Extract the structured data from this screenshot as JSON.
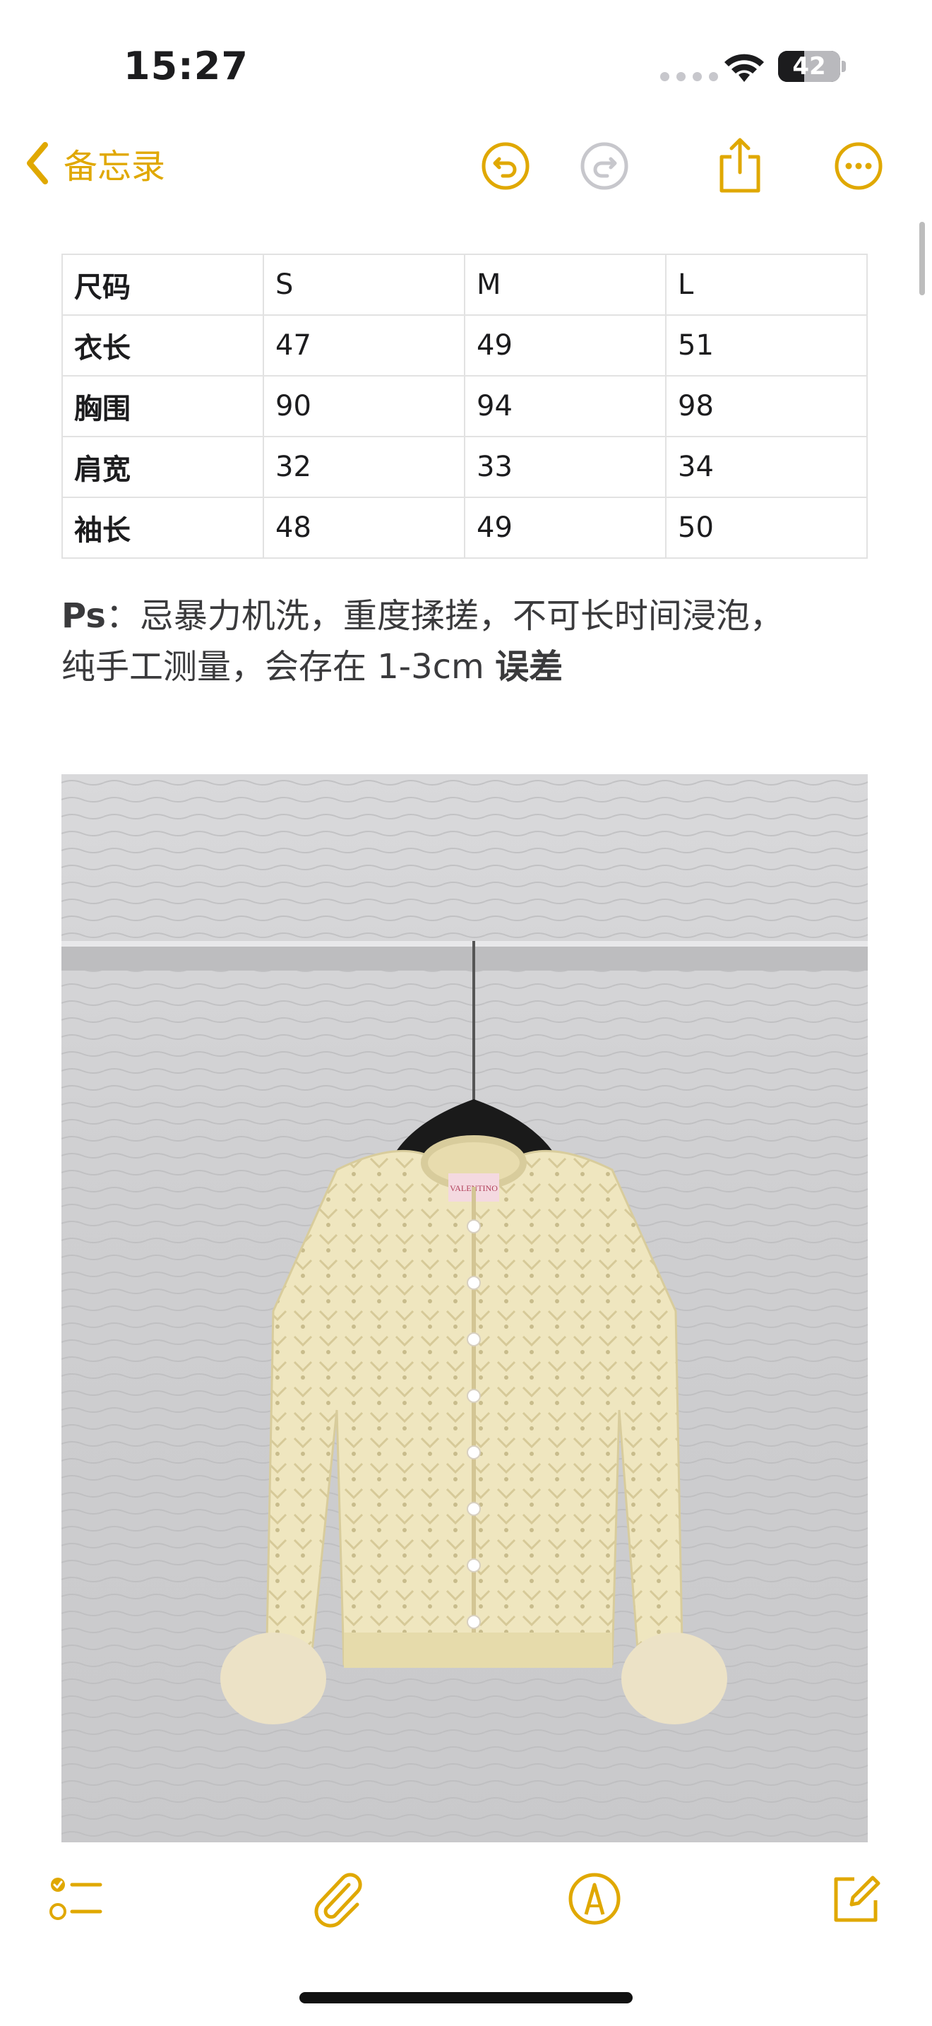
{
  "status_bar": {
    "time": "15:27",
    "battery": "42",
    "battery_level_fraction": 0.42
  },
  "nav": {
    "back_label": "备忘录",
    "accent_color": "#e0a800",
    "icons": [
      "undo-icon",
      "redo-icon",
      "share-icon",
      "more-icon"
    ]
  },
  "size_table": {
    "rows": [
      [
        "尺码",
        "S",
        "M",
        "L"
      ],
      [
        "衣长",
        "47",
        "49",
        "51"
      ],
      [
        "胸围",
        "90",
        "94",
        "98"
      ],
      [
        "肩宽",
        "32",
        "33",
        "34"
      ],
      [
        "袖长",
        "48",
        "49",
        "50"
      ]
    ]
  },
  "note": {
    "prefix": "Ps",
    "line1": "：忌暴力机洗，重度揉搓，不可长时间浸泡，",
    "line2_a": "纯手工测量，会存在 1-3cm ",
    "line2_b": "误差"
  },
  "photo": {
    "label_text": "VALENTINO",
    "description_icon": "cardigan-photo"
  },
  "toolbar": {
    "icons": [
      "checklist-icon",
      "paperclip-icon",
      "markup-pen-icon",
      "compose-icon"
    ]
  }
}
